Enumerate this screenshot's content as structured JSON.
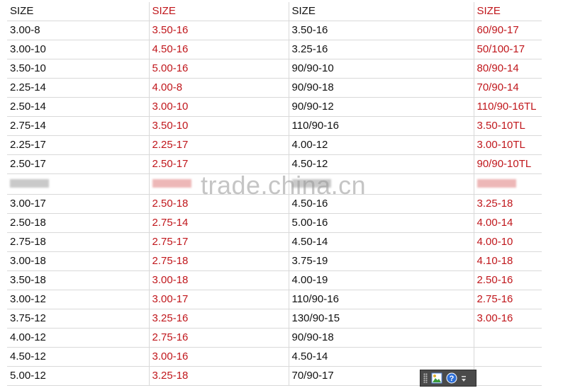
{
  "table": {
    "rows": [
      [
        "SIZE",
        "SIZE",
        "SIZE",
        "SIZE"
      ],
      [
        "3.00-8",
        "3.50-16",
        "3.50-16",
        "60/90-17"
      ],
      [
        "3.00-10",
        "4.50-16",
        "3.25-16",
        "50/100-17"
      ],
      [
        "3.50-10",
        "5.00-16",
        "90/90-10",
        "80/90-14"
      ],
      [
        "2.25-14",
        "4.00-8",
        "90/90-18",
        "70/90-14"
      ],
      [
        "2.50-14",
        "3.00-10",
        "90/90-12",
        "110/90-16TL"
      ],
      [
        "2.75-14",
        "3.50-10",
        "110/90-16",
        "3.50-10TL"
      ],
      [
        "2.25-17",
        "2.25-17",
        "4.00-12",
        "3.00-10TL"
      ],
      [
        "2.50-17",
        "2.50-17",
        "4.50-12",
        "90/90-10TL"
      ],
      [
        "",
        "",
        "",
        ""
      ],
      [
        "3.00-17",
        "2.50-18",
        "4.50-16",
        "3.25-18"
      ],
      [
        "2.50-18",
        "2.75-14",
        "5.00-16",
        "4.00-14"
      ],
      [
        "2.75-18",
        "2.75-17",
        "4.50-14",
        "4.00-10"
      ],
      [
        "3.00-18",
        "2.75-18",
        "3.75-19",
        "4.10-18"
      ],
      [
        "3.50-18",
        "3.00-18",
        "4.00-19",
        "2.50-16"
      ],
      [
        "3.00-12",
        "3.00-17",
        "110/90-16",
        "2.75-16"
      ],
      [
        "3.75-12",
        "3.25-16",
        "130/90-15",
        "3.00-16"
      ],
      [
        "4.00-12",
        "2.75-16",
        "90/90-18",
        ""
      ],
      [
        "4.50-12",
        "3.00-16",
        "4.50-14",
        ""
      ],
      [
        "5.00-12",
        "3.25-18",
        "70/90-17",
        ""
      ]
    ],
    "blurred_row": 9,
    "column_colors": [
      "#111111",
      "#c0161b",
      "#111111",
      "#c0161b"
    ]
  },
  "watermark": {
    "text": "trade.china.cn"
  },
  "toolbar": {
    "icons": [
      "grip-icon",
      "picture-icon",
      "help-icon",
      "chevron-down-icon"
    ],
    "accent": "#2f6fd6"
  }
}
